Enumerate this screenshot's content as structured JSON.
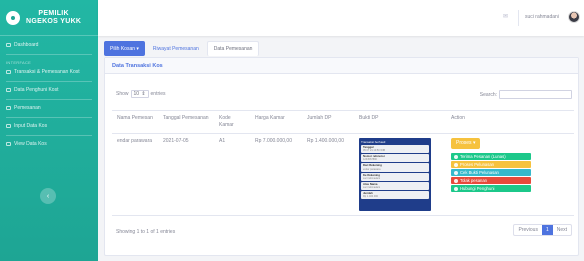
{
  "brand": {
    "line1": "PEMILIK",
    "line2": "NGEKOS YUKK"
  },
  "sidebar": {
    "dashboard": "Dashboard",
    "heading": "INTERFACE",
    "items": [
      "Transaksi & Pemesanan Kost",
      "Data Penghuni Kost",
      "Pemesanan",
      "Input Data Kos",
      "View Data Kos"
    ],
    "toggle_glyph": "‹"
  },
  "topbar": {
    "user_name": "suci rahmadani",
    "mail_glyph": "✉"
  },
  "tabs": {
    "dropdown": "Pilih Kosan ▾",
    "history": "Riwayat Pemesanan",
    "orders": "Data Pemesanan"
  },
  "card": {
    "title": "Data Transaksi Kos"
  },
  "controls": {
    "show": "Show",
    "entries_value": "10",
    "entries": "entries",
    "search": "Search:"
  },
  "table": {
    "headers": [
      "Nama Pemesan",
      "Tanggal Pemesanan",
      "Kode Kamar",
      "Harga Kamar",
      "Jumlah DP",
      "Bukti DP",
      "Action"
    ],
    "rows": [
      {
        "nama": "endar parawara",
        "tanggal": "2021-07-05",
        "kode": "A1",
        "harga": "Rp 7.000.000,00",
        "dp": "Rp 1.400.000,00"
      }
    ]
  },
  "receipt": {
    "title": "Transaksi berhasil",
    "rows": [
      {
        "label": "Tanggal",
        "value": "05 07 21 10:50 WIB"
      },
      {
        "label": "Nomor referensi",
        "value": "1234567890"
      },
      {
        "label": "Dari Rekening",
        "value": "endar parawara"
      },
      {
        "label": "Ke Rekening",
        "value": "suci rahmadani"
      },
      {
        "label": "Atas Nama",
        "value": "suci rahmadani"
      },
      {
        "label": "Jumlah",
        "value": "Rp 1.400.000"
      }
    ]
  },
  "actions": {
    "proses": "Proses ▾",
    "items": [
      {
        "label": "Terima Pesanan (Lunas)",
        "color": "#1cc88a"
      },
      {
        "label": "Proses Pelunasan",
        "color": "#f6c23e"
      },
      {
        "label": "Cek Bukti Pelunasan",
        "color": "#36b9cc"
      },
      {
        "label": "Tolak pesanan",
        "color": "#e74a3b"
      },
      {
        "label": "Hubungi Penghuni",
        "color": "#1cc88a"
      }
    ]
  },
  "footer": {
    "info": "Showing 1 to 1 of 1 entries",
    "previous": "Previous",
    "page": "1",
    "next": "Next"
  }
}
